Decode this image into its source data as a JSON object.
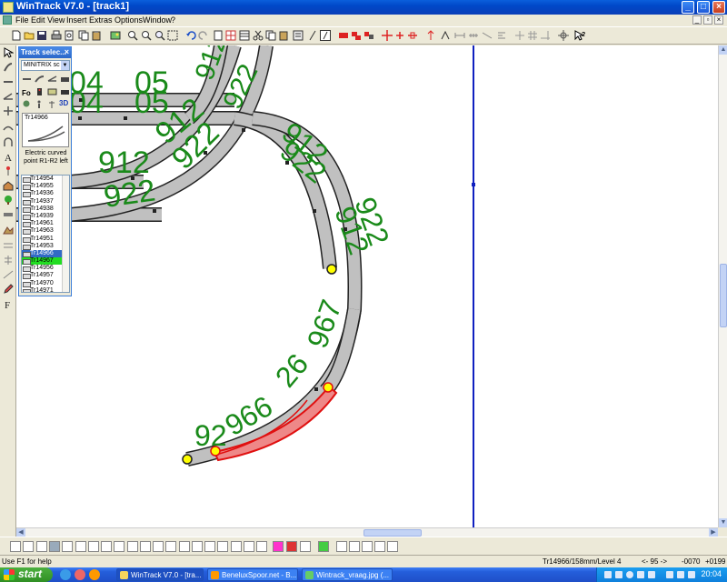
{
  "window": {
    "title": "WinTrack  V7.0 - [track1]",
    "min": "_",
    "max": "□",
    "close": "×"
  },
  "menu": [
    "File",
    "Edit",
    "View",
    "Insert",
    "Extras",
    "Options",
    "Window",
    "?"
  ],
  "track_panel": {
    "title": "Track selec...",
    "close": "×",
    "manufacturer": "MINITRIX sc",
    "label_3d": "3D",
    "preview_id": "Tr14966",
    "description_line1": "Electric curved",
    "description_line2": "point  R1-R2 left",
    "items": [
      "Tr14954",
      "Tr14955",
      "Tr14936",
      "Tr14937",
      "Tr14938",
      "Tr14939",
      "Tr14961",
      "Tr14963",
      "Tr14951",
      "Tr14953",
      "Tr14966",
      "Tr14967",
      "Tr14956",
      "Tr14957",
      "Tr14970",
      "Tr14971"
    ],
    "selected_index": 10,
    "highlight_index": 11
  },
  "canvas": {
    "labels": [
      "04",
      "05",
      "04",
      "05",
      "912",
      "912",
      "922",
      "922",
      "912",
      "922",
      "912",
      "922",
      "912",
      "922",
      "967",
      "26",
      "966",
      "92"
    ],
    "colors": {
      "track_fill": "#c0c0c0",
      "track_edge": "#222222",
      "label": "#1a8a1a",
      "selection": "#e01010",
      "endpoint": "#ffff00",
      "divider": "#1020c0"
    }
  },
  "status": {
    "help": "Use F1 for help",
    "track_info": "Tr14966/158mm/Level 4",
    "angle": "<- 95 ->",
    "x": "-0070",
    "y": "+0199"
  },
  "taskbar": {
    "start": "start",
    "tasks": [
      "WinTrack  V7.0 - [tra...",
      "BeneluxSpoor.net - B...",
      "Wintrack_vraag.jpg (..."
    ],
    "clock": "20:04"
  }
}
